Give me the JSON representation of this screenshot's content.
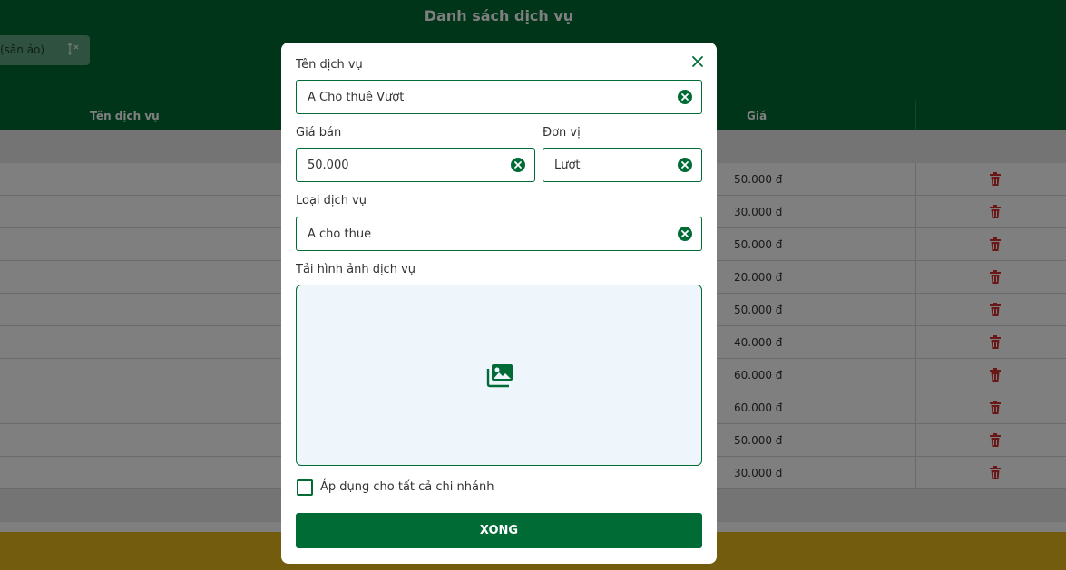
{
  "background": {
    "page_title": "Danh sách dịch vụ",
    "filter_text": "(sân ảo)",
    "columns": {
      "name": "Tên dịch vụ",
      "price": "Giá"
    },
    "prices": [
      "50.000 đ",
      "30.000 đ",
      "50.000 đ",
      "20.000 đ",
      "50.000 đ",
      "40.000 đ",
      "60.000 đ",
      "60.000 đ",
      "50.000 đ",
      "30.000 đ"
    ]
  },
  "modal": {
    "name_label": "Tên dịch vụ",
    "name_value": "A Cho thuê Vượt",
    "price_label": "Giá bán",
    "price_value": "50.000",
    "unit_label": "Đơn vị",
    "unit_value": "Lượt",
    "type_label": "Loại dịch vụ",
    "type_value": "A cho thue",
    "image_label": "Tải hình ảnh dịch vụ",
    "apply_all_label": "Áp dụng cho tất cả chi nhánh",
    "done_label": "XONG"
  },
  "colors": {
    "primary": "#006b35",
    "danger": "#d32f2f",
    "footer": "#e6b81b",
    "upload_bg": "#eef6fc"
  },
  "icons": {
    "close": "close-icon",
    "clear": "clear-circle-icon",
    "upload": "images-icon",
    "delete": "trash-icon"
  }
}
